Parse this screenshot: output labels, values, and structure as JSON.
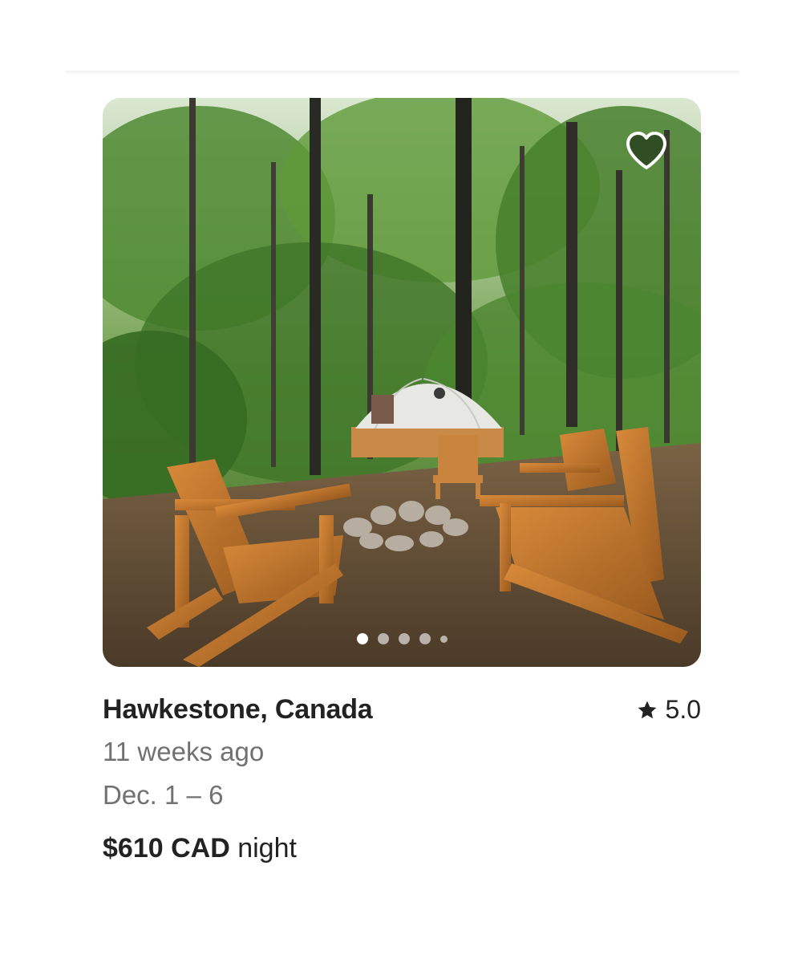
{
  "listing": {
    "location": "Hawkestone, Canada",
    "rating": "5.0",
    "posted": "11 weeks ago",
    "dates": "Dec. 1 – 6",
    "price_amount": "$610 CAD",
    "price_unit": "night"
  },
  "carousel": {
    "total_dots": 5,
    "active_index": 0
  },
  "icons": {
    "favorite": "heart-icon",
    "rating": "star-icon"
  },
  "colors": {
    "primary_text": "#222222",
    "secondary_text": "#717171"
  }
}
